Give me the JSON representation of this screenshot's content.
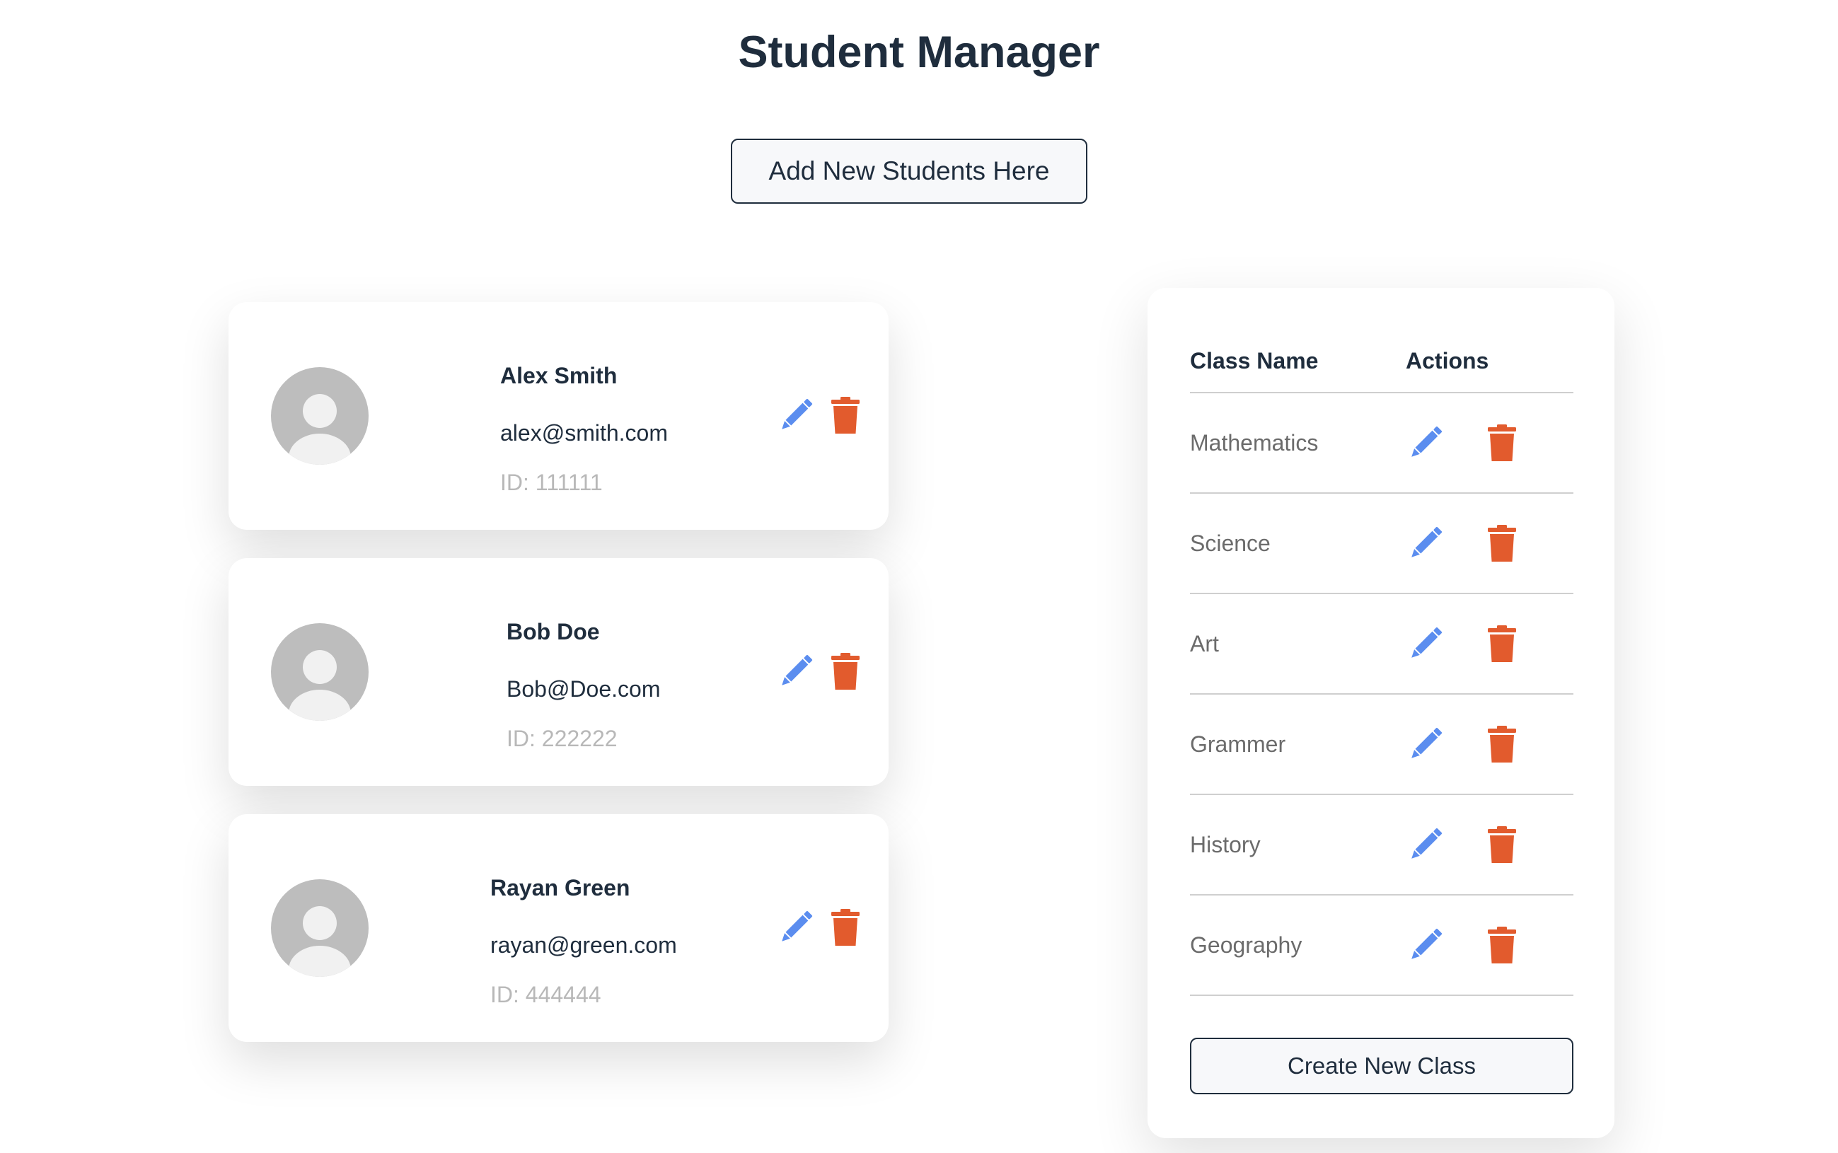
{
  "header": {
    "title": "Student Manager",
    "add_button_label": "Add New Students Here"
  },
  "colors": {
    "edit_icon": "#5b8def",
    "delete_icon": "#e25b2d",
    "avatar_bg": "#bdbdbd",
    "text_dark": "#1f2d3d",
    "text_muted": "#b8b8b8"
  },
  "students": [
    {
      "name": "Alex Smith",
      "email": "alex@smith.com",
      "id": "ID: 111111",
      "avatar_icon": "user-avatar-icon",
      "edit_icon": "pencil-icon",
      "delete_icon": "trash-icon"
    },
    {
      "name": "Bob Doe",
      "email": "Bob@Doe.com",
      "id": "ID: 222222",
      "avatar_icon": "user-avatar-icon",
      "edit_icon": "pencil-icon",
      "delete_icon": "trash-icon"
    },
    {
      "name": "Rayan Green",
      "email": "rayan@green.com",
      "id": "ID: 444444",
      "avatar_icon": "user-avatar-icon",
      "edit_icon": "pencil-icon",
      "delete_icon": "trash-icon"
    }
  ],
  "classes": {
    "headers": [
      "Class Name",
      "Actions"
    ],
    "rows": [
      {
        "name": "Mathematics"
      },
      {
        "name": "Science"
      },
      {
        "name": "Art"
      },
      {
        "name": "Grammer"
      },
      {
        "name": "History"
      },
      {
        "name": "Geography"
      }
    ],
    "create_button_label": "Create New Class"
  }
}
